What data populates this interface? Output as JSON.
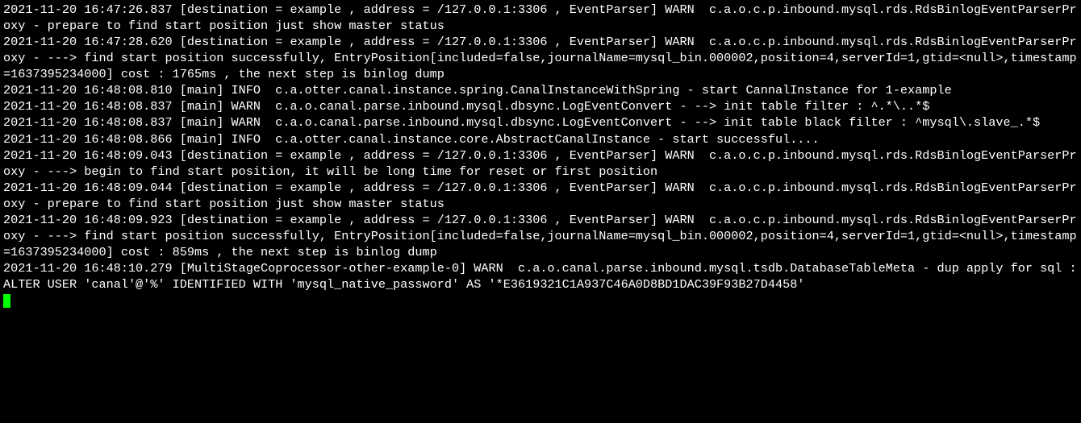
{
  "logs": [
    {
      "text": "2021-11-20 16:47:26.837 [destination = example , address = /127.0.0.1:3306 , EventParser] WARN  c.a.o.c.p.inbound.mysql.rds.RdsBinlogEventParserProxy - prepare to find start position just show master status"
    },
    {
      "text": "2021-11-20 16:47:28.620 [destination = example , address = /127.0.0.1:3306 , EventParser] WARN  c.a.o.c.p.inbound.mysql.rds.RdsBinlogEventParserProxy - ---> find start position successfully, EntryPosition[included=false,journalName=mysql_bin.000002,position=4,serverId=1,gtid=<null>,timestamp=1637395234000] cost : 1765ms , the next step is binlog dump"
    },
    {
      "text": "2021-11-20 16:48:08.810 [main] INFO  c.a.otter.canal.instance.spring.CanalInstanceWithSpring - start CannalInstance for 1-example"
    },
    {
      "text": "2021-11-20 16:48:08.837 [main] WARN  c.a.o.canal.parse.inbound.mysql.dbsync.LogEventConvert - --> init table filter : ^.*\\..*$"
    },
    {
      "text": "2021-11-20 16:48:08.837 [main] WARN  c.a.o.canal.parse.inbound.mysql.dbsync.LogEventConvert - --> init table black filter : ^mysql\\.slave_.*$"
    },
    {
      "text": "2021-11-20 16:48:08.866 [main] INFO  c.a.otter.canal.instance.core.AbstractCanalInstance - start successful...."
    },
    {
      "text": "2021-11-20 16:48:09.043 [destination = example , address = /127.0.0.1:3306 , EventParser] WARN  c.a.o.c.p.inbound.mysql.rds.RdsBinlogEventParserProxy - ---> begin to find start position, it will be long time for reset or first position"
    },
    {
      "text": "2021-11-20 16:48:09.044 [destination = example , address = /127.0.0.1:3306 , EventParser] WARN  c.a.o.c.p.inbound.mysql.rds.RdsBinlogEventParserProxy - prepare to find start position just show master status"
    },
    {
      "text": "2021-11-20 16:48:09.923 [destination = example , address = /127.0.0.1:3306 , EventParser] WARN  c.a.o.c.p.inbound.mysql.rds.RdsBinlogEventParserProxy - ---> find start position successfully, EntryPosition[included=false,journalName=mysql_bin.000002,position=4,serverId=1,gtid=<null>,timestamp=1637395234000] cost : 859ms , the next step is binlog dump"
    },
    {
      "text": "2021-11-20 16:48:10.279 [MultiStageCoprocessor-other-example-0] WARN  c.a.o.canal.parse.inbound.mysql.tsdb.DatabaseTableMeta - dup apply for sql : ALTER USER 'canal'@'%' IDENTIFIED WITH 'mysql_native_password' AS '*E3619321C1A937C46A0D8BD1DAC39F93B27D4458'"
    }
  ]
}
